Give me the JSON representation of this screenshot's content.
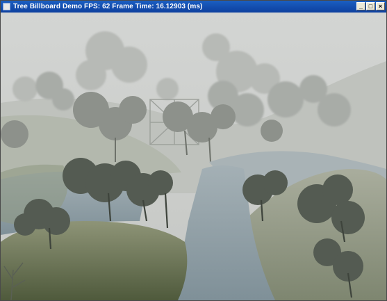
{
  "window": {
    "title": "Tree Billboard Demo    FPS: 62    Frame Time: 16.12903 (ms)",
    "controls": {
      "minimize": "_",
      "maximize": "□",
      "close": "×"
    }
  },
  "scene": {
    "description_icon": "3d-viewport",
    "fog_color": "#c9cbc9",
    "water_color": "#8fa0a8",
    "hill_color": "#6f7a5c"
  }
}
